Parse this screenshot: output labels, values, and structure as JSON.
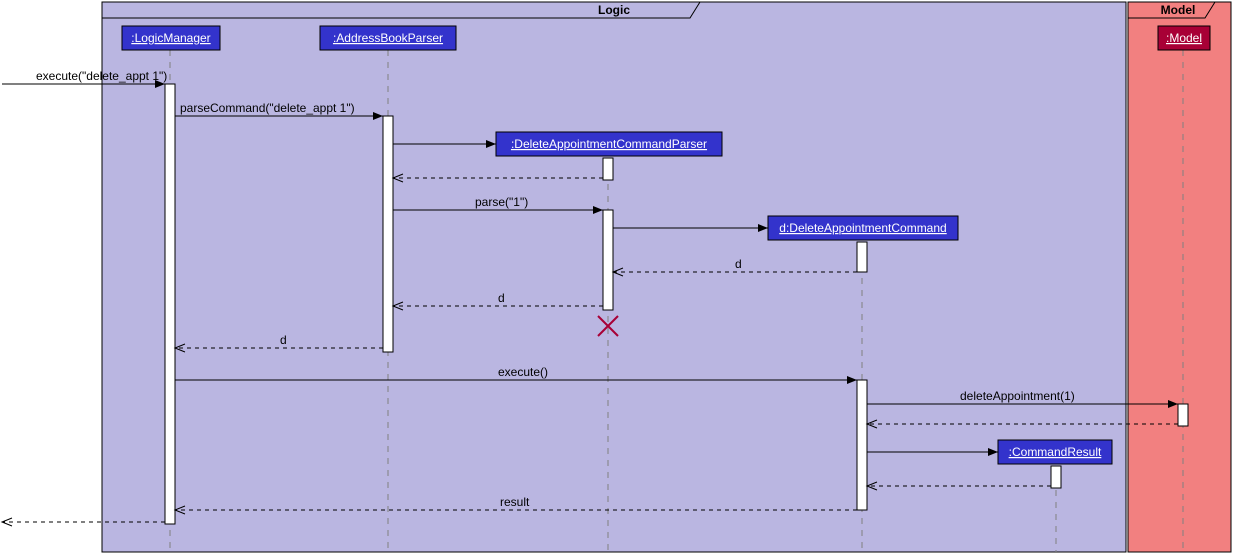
{
  "frames": {
    "logic": "Logic",
    "model": "Model"
  },
  "participants": {
    "logicManager": ":LogicManager",
    "addressBookParser": ":AddressBookParser",
    "deleteApptCmdParser": ":DeleteAppointmentCommandParser",
    "deleteApptCmd": "d:DeleteAppointmentCommand",
    "commandResult": ":CommandResult",
    "model": ":Model"
  },
  "messages": {
    "execIn": "execute(\"delete_appt 1\")",
    "parseCommand": "parseCommand(\"delete_appt 1\")",
    "parse": "parse(\"1\")",
    "retD1": "d",
    "retD2": "d",
    "retD3": "d",
    "execute": "execute()",
    "deleteAppointment": "deleteAppointment(1)",
    "result": "result"
  }
}
